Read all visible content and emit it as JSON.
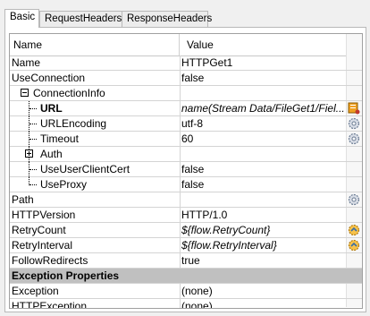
{
  "tabs": [
    {
      "label": "Basic",
      "active": true
    },
    {
      "label": "RequestHeaders",
      "active": false
    },
    {
      "label": "ResponseHeaders",
      "active": false
    }
  ],
  "columns": {
    "name": "Name",
    "value": "Value"
  },
  "rows": [
    {
      "name": "Name",
      "value": "HTTPGet1"
    },
    {
      "name": "UseConnection",
      "value": "false"
    },
    {
      "name": "ConnectionInfo",
      "value": ""
    },
    {
      "name": "URL",
      "value": "name(Stream Data/FileGet1/Fiel..."
    },
    {
      "name": "URLEncoding",
      "value": "utf-8"
    },
    {
      "name": "Timeout",
      "value": "60"
    },
    {
      "name": "Auth",
      "value": ""
    },
    {
      "name": "UseUserClientCert",
      "value": "false"
    },
    {
      "name": "UseProxy",
      "value": "false"
    },
    {
      "name": "Path",
      "value": ""
    },
    {
      "name": "HTTPVersion",
      "value": "HTTP/1.0"
    },
    {
      "name": "RetryCount",
      "value": "${flow.RetryCount}"
    },
    {
      "name": "RetryInterval",
      "value": "${flow.RetryInterval}"
    },
    {
      "name": "FollowRedirects",
      "value": "true"
    },
    {
      "name": "Exception Properties",
      "value": ""
    },
    {
      "name": "Exception",
      "value": "(none)"
    },
    {
      "name": "HTTPException",
      "value": "(none)"
    }
  ],
  "icons": {
    "url_button": "edit-bind-icon",
    "dropdown_button": "gear-icon",
    "reset_button": "reset-gear-icon"
  },
  "colors": {
    "section_bg": "#c0c0c0",
    "icon_orange": "#f0a020",
    "icon_blue": "#3a6ea5"
  }
}
